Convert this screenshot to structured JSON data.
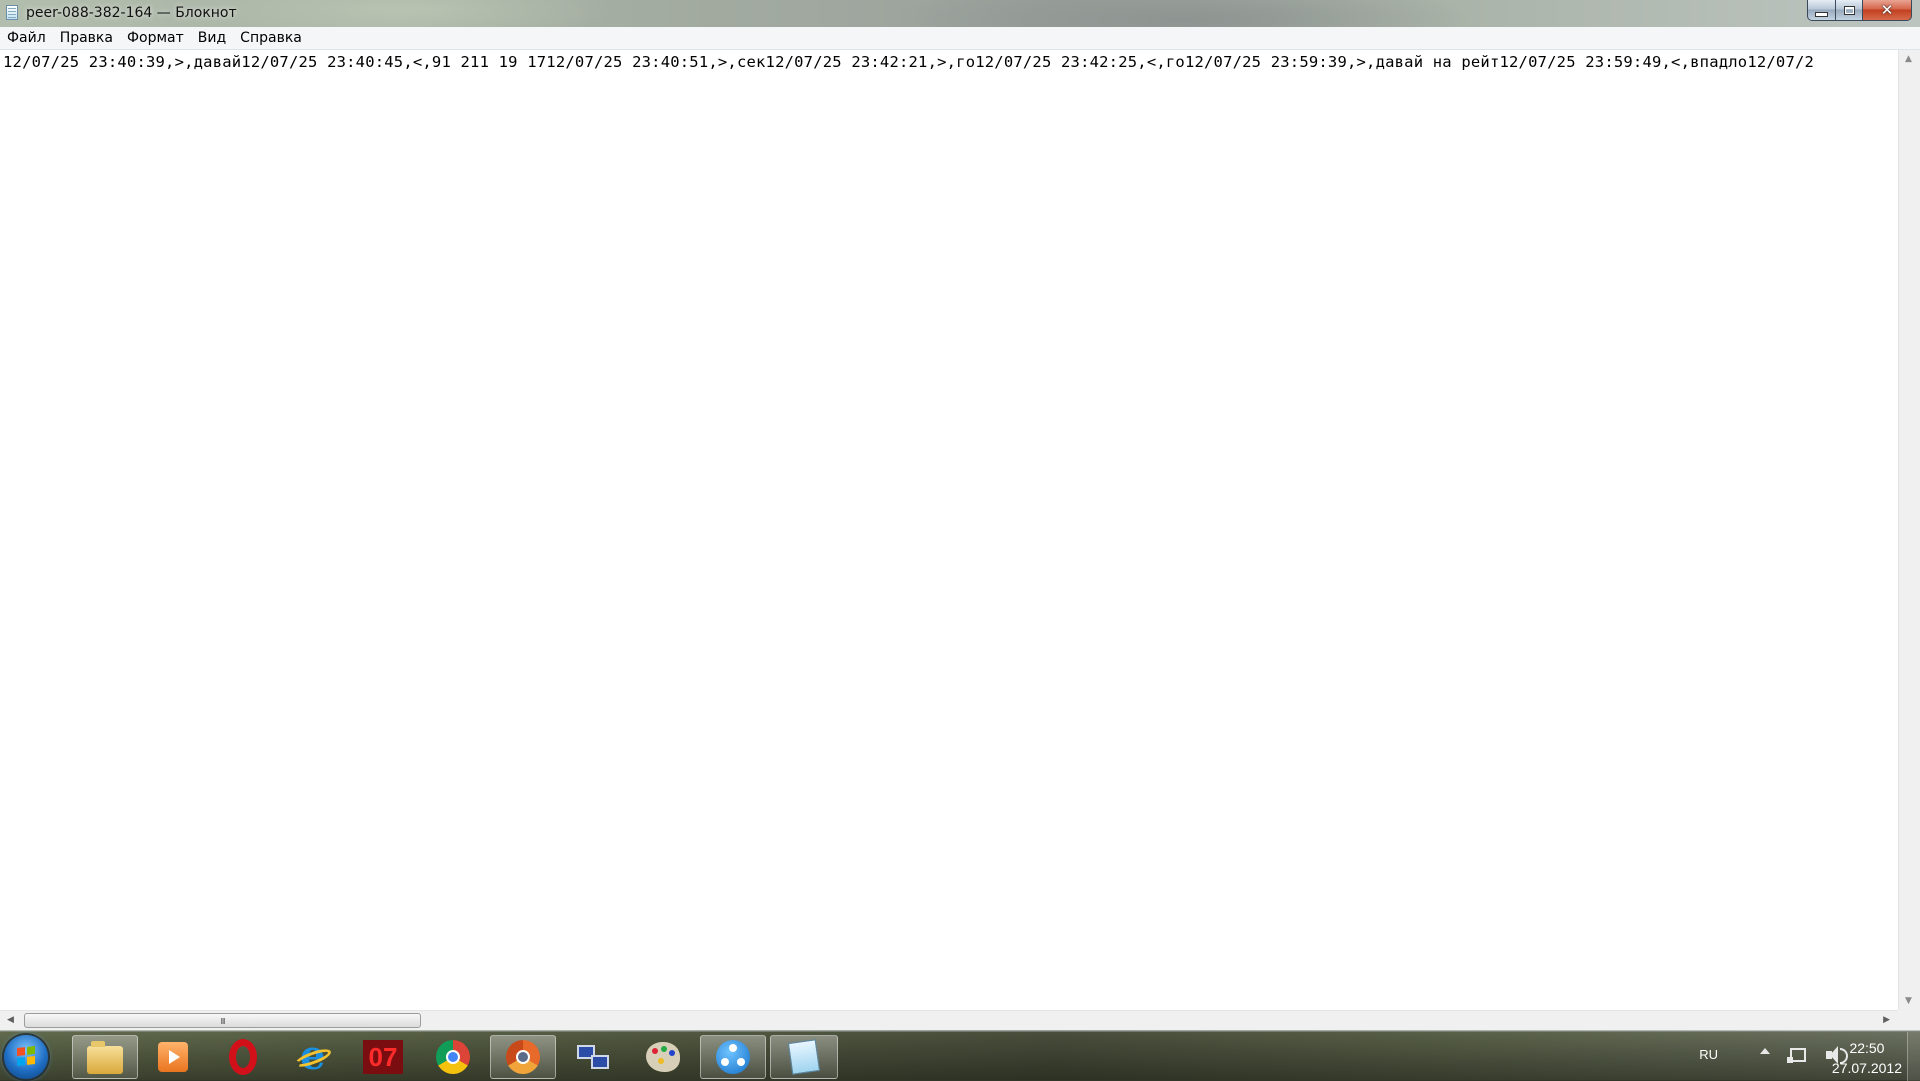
{
  "window": {
    "title": "peer-088-382-164 — Блокнот",
    "controls": {
      "minimize": "minimize-icon",
      "maximize": "maximize-icon",
      "close": "close-icon"
    }
  },
  "menu": {
    "items": [
      "Файл",
      "Правка",
      "Формат",
      "Вид",
      "Справка"
    ]
  },
  "editor": {
    "content": "12/07/25 23:40:39,>,давай12/07/25 23:40:45,<,91 211 19 1712/07/25 23:40:51,>,сек12/07/25 23:42:21,>,го12/07/25 23:42:25,<,го12/07/25 23:59:39,>,давай на рейт12/07/25 23:59:49,<,впадло12/07/2"
  },
  "scrollbars": {
    "horizontal_grip": "III",
    "left_arrow": "◀",
    "right_arrow": "▶",
    "up_arrow": "▲",
    "down_arrow": "▼"
  },
  "taskbar": {
    "start": "windows-start-icon",
    "buttons": [
      {
        "name": "explorer-icon",
        "active": true
      },
      {
        "name": "media-player-icon",
        "active": false
      },
      {
        "name": "opera-icon",
        "active": false
      },
      {
        "name": "internet-explorer-icon",
        "active": false
      },
      {
        "name": "app-07-icon",
        "label": "07",
        "active": false
      },
      {
        "name": "chrome-icon",
        "active": false
      },
      {
        "name": "chromium-icon",
        "active": true
      },
      {
        "name": "network-icon",
        "active": false
      },
      {
        "name": "paint-icon",
        "active": false
      },
      {
        "name": "shareman-icon",
        "active": true
      },
      {
        "name": "notepad-icon",
        "active": true
      }
    ]
  },
  "tray": {
    "language": "RU",
    "time": "22:50",
    "date": "27.07.2012"
  }
}
